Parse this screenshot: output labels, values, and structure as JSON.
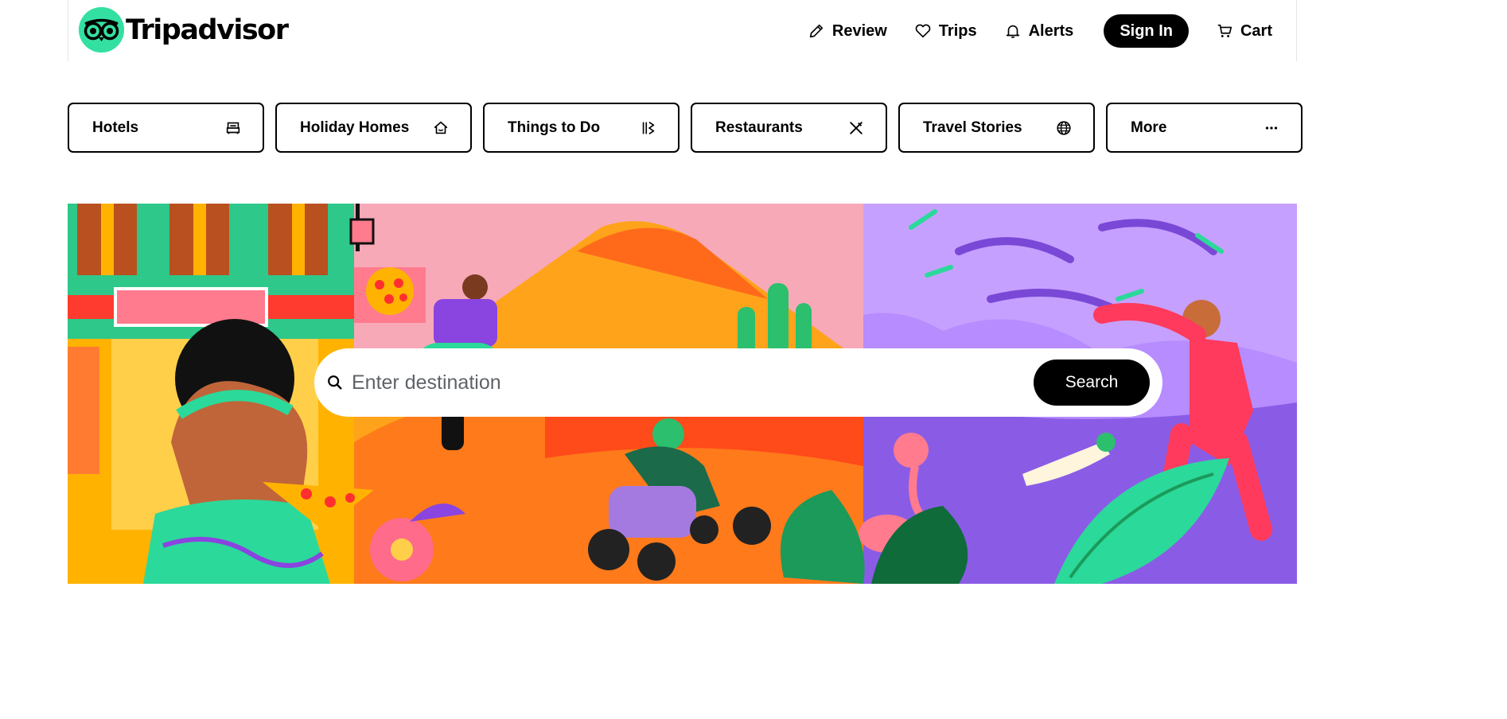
{
  "header": {
    "logo_text": "Tripadvisor",
    "nav": {
      "review": "Review",
      "trips": "Trips",
      "alerts": "Alerts",
      "signin": "Sign In",
      "cart": "Cart"
    }
  },
  "tabs": [
    {
      "label": "Hotels",
      "icon": "bed-icon"
    },
    {
      "label": "Holiday Homes",
      "icon": "home-icon"
    },
    {
      "label": "Things to Do",
      "icon": "ticket-icon"
    },
    {
      "label": "Restaurants",
      "icon": "utensils-icon"
    },
    {
      "label": "Travel Stories",
      "icon": "globe-icon"
    },
    {
      "label": "More",
      "icon": "more-dots-icon"
    }
  ],
  "hero": {
    "search": {
      "placeholder": "Enter destination",
      "button_label": "Search"
    }
  },
  "colors": {
    "brand_green": "#34e0a1",
    "black": "#000000"
  }
}
